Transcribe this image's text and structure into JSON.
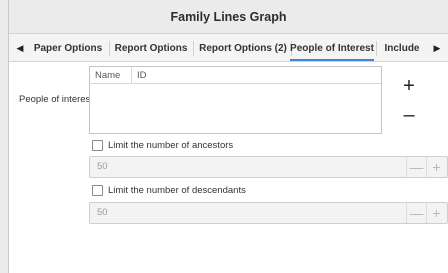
{
  "window": {
    "title": "Family Lines Graph"
  },
  "tabs": [
    {
      "label": "Paper Options"
    },
    {
      "label": "Report Options"
    },
    {
      "label": "Report Options (2)"
    },
    {
      "label": "People of Interest",
      "active": true
    },
    {
      "label": "Include"
    }
  ],
  "tab_nav": {
    "left_icon": "triangle-left-icon",
    "right_icon": "triangle-right-icon"
  },
  "people_of_interest": {
    "label": "People of interest:",
    "columns": [
      "Name",
      "ID"
    ],
    "rows": [],
    "add_icon": "plus-icon",
    "remove_icon": "minus-icon"
  },
  "limit_ancestors": {
    "label": "Limit the number of ancestors",
    "checked": false,
    "value": "50"
  },
  "limit_descendants": {
    "label": "Limit the number of descendants",
    "checked": false,
    "value": "50"
  },
  "colors": {
    "accent": "#3b86d8"
  }
}
